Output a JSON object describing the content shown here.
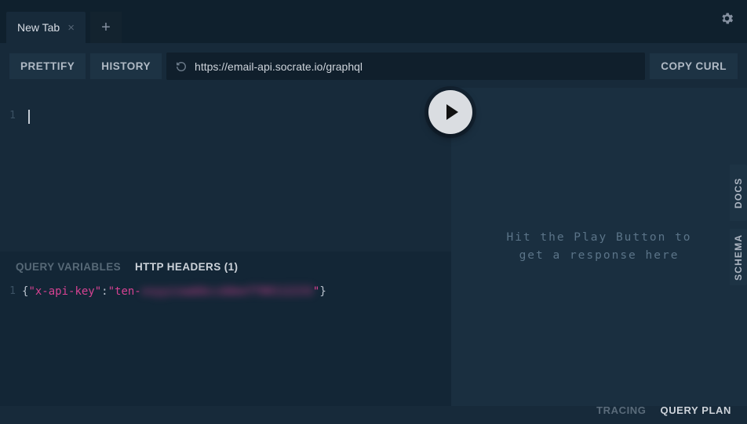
{
  "tabs": {
    "active_label": "New Tab"
  },
  "toolbar": {
    "prettify": "PRETTIFY",
    "history": "HISTORY",
    "url": "https://email-api.socrate.io/graphql",
    "copy_curl": "COPY CURL"
  },
  "editor": {
    "line1": "1"
  },
  "bottom": {
    "query_variables": "QUERY VARIABLES",
    "http_headers": "HTTP HEADERS (1)"
  },
  "headers": {
    "line1": "1",
    "open": "{",
    "key": "\"x-api-key\"",
    "colon": ":",
    "value_prefix": "\"ten-",
    "value_blurred": "xxyyzzaabbccddeeff00112233",
    "value_close": "\"",
    "close": "}"
  },
  "response_placeholder": {
    "line1": "Hit the Play Button to",
    "line2": "get a response here"
  },
  "side": {
    "docs": "DOCS",
    "schema": "SCHEMA"
  },
  "footer": {
    "tracing": "TRACING",
    "query_plan": "QUERY PLAN"
  }
}
